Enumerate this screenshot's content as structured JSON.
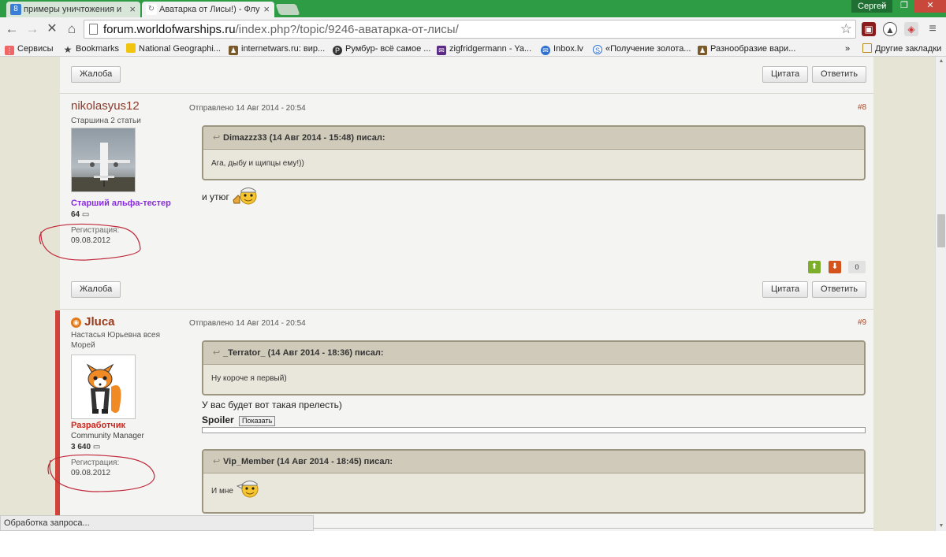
{
  "browser": {
    "tabs": [
      {
        "label": "примеры уничтожения и",
        "favicon": "search-favicon"
      },
      {
        "label": "Аватарка от Лисы!) - Флу",
        "favicon": "forum-favicon"
      }
    ],
    "user": "Сергей",
    "url_host": "forum.worldofwarships.ru",
    "url_path": "/index.php?/topic/9246-аватарка-от-лисы/",
    "status": "Обработка запроса..."
  },
  "bookmarks": {
    "apps": "Сервисы",
    "items": [
      "Bookmarks",
      "National Geographi...",
      "internetwars.ru: вир...",
      "Румбур- всё самое ...",
      "zigfridgermann - Ya...",
      "Inbox.lv",
      "«Получение золота...",
      "Разнообразие вари..."
    ],
    "other": "Другие закладки",
    "more": "»"
  },
  "buttons": {
    "report": "Жалоба",
    "quote": "Цитата",
    "reply": "Ответить"
  },
  "posts": [
    {
      "author": "nikolasyus12",
      "title": "Старшина 2 статьи",
      "group": "Старший альфа-тестер",
      "group_color": "#8a2be2",
      "post_count": "64",
      "reg_label": "Регистрация:",
      "reg_date": "09.08.2012",
      "posted": "Отправлено 14 Авг 2014 - 20:54",
      "number": "#8",
      "quote_header": "Dimazzz33 (14 Авг 2014 - 15:48) писал:",
      "quote_body": "Ага, дыбу и щипцы ему!))",
      "text": "и утюг",
      "rating": "0"
    },
    {
      "author": "Jluca",
      "title": "Настасья Юрьевна всея Морей",
      "group": "Разработчик",
      "group_color": "#d0241c",
      "role": "Community Manager",
      "post_count": "3 640",
      "reg_label": "Регистрация:",
      "reg_date": "09.08.2012",
      "posted": "Отправлено 14 Авг 2014 - 20:54",
      "number": "#9",
      "quote_header": "_Terrator_ (14 Авг 2014 - 18:36) писал:",
      "quote_body": "Ну короче я первый)",
      "text": "У вас будет вот такая прелесть)",
      "spoiler_label": "Spoiler",
      "spoiler_button": "Показать",
      "quote2_header": "Vip_Member (14 Авг 2014 - 18:45) писал:",
      "quote2_body": "И мне"
    }
  ]
}
